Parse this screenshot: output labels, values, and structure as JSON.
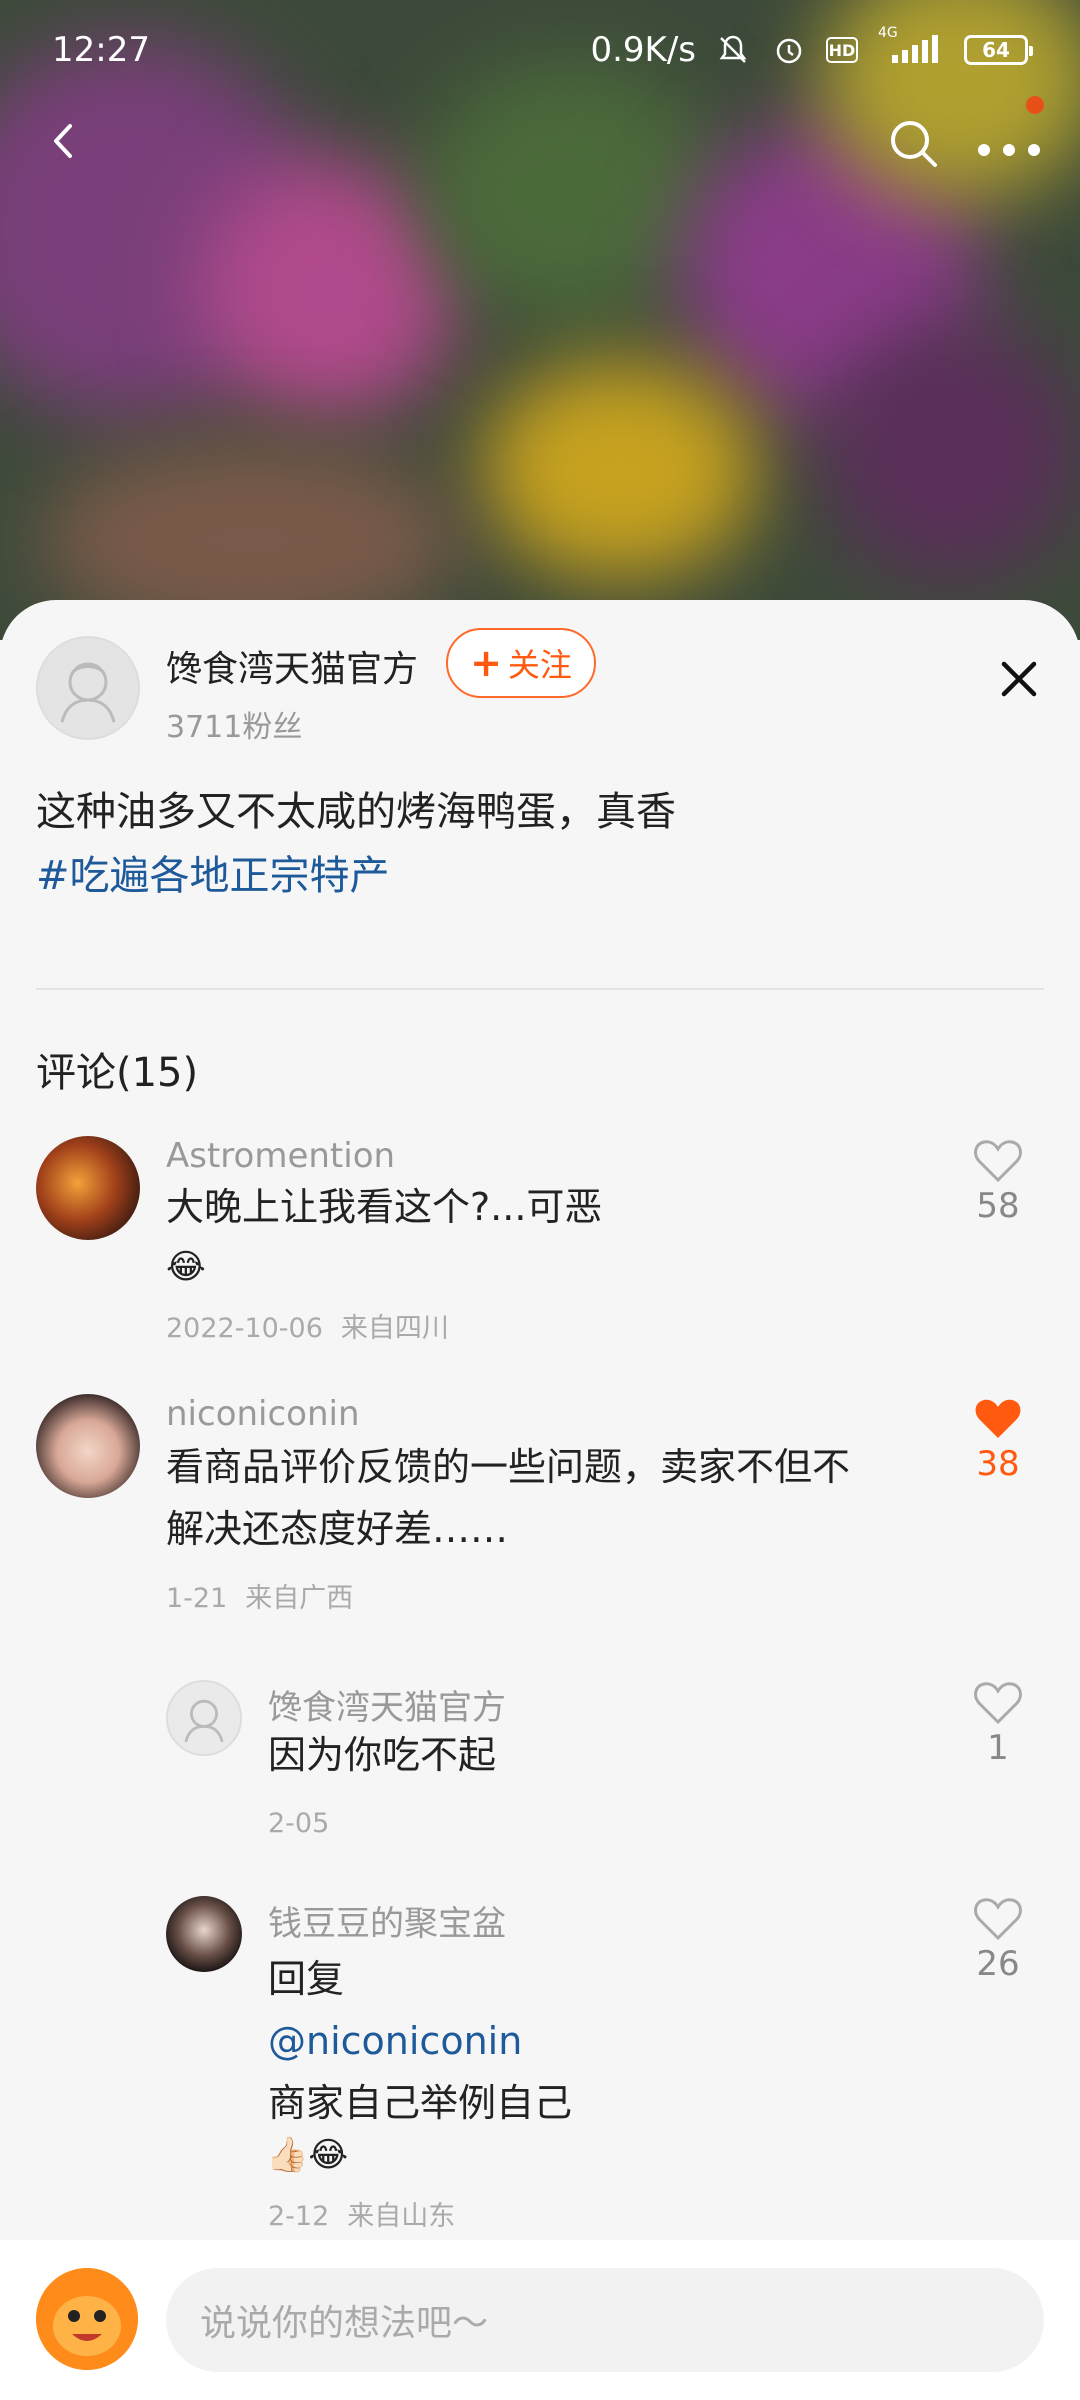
{
  "status_bar": {
    "time": "12:27",
    "network_speed": "0.9K/s",
    "signal_type": "4G",
    "battery": "64",
    "hd": "HD"
  },
  "nav": {
    "back_icon": "chevron-left-icon",
    "search_icon": "search-icon",
    "more_icon": "more-dots-icon"
  },
  "post": {
    "author": "馋食湾天猫官方",
    "follow_label": "关注",
    "fans": "3711粉丝",
    "text": "这种油多又不太咸的烤海鸭蛋，真香",
    "hashtag": "#吃遍各地正宗特产"
  },
  "comments_title": "评论(15)",
  "comments": [
    {
      "name": "Astromention",
      "text": "大晚上让我看这个?...可恶",
      "emoji": "😂",
      "date": "2022-10-06",
      "location": "来自四川",
      "likes": "58",
      "liked": false
    },
    {
      "name": "niconiconin",
      "text_line1": "看商品评价反馈的一些问题，卖家不但不",
      "text_line2": "解决还态度好差……",
      "date": "1-21",
      "location": "来自广西",
      "likes": "38",
      "liked": true
    }
  ],
  "replies": [
    {
      "name": "馋食湾天猫官方",
      "text": "因为你吃不起",
      "date": "2-05",
      "likes": "1"
    },
    {
      "name": "钱豆豆的聚宝盆",
      "text_line1": "回复",
      "mention": "@niconiconin",
      "text_line3": "商家自己举例自己",
      "emoji": "👍🏻😂",
      "date": "2-12",
      "location": "来自山东",
      "likes": "26"
    }
  ],
  "input": {
    "placeholder": "说说你的想法吧～"
  },
  "colors": {
    "accent": "#ff5a10",
    "link": "#1e5a9a"
  }
}
